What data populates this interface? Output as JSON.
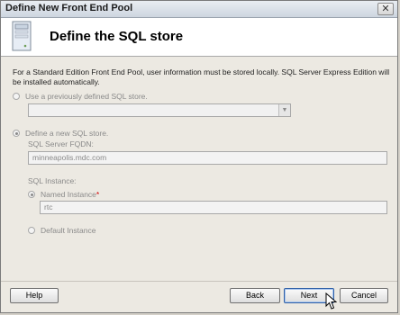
{
  "window": {
    "title": "Define New Front End Pool",
    "close_glyph": "✕"
  },
  "header": {
    "title": "Define the SQL store",
    "icon": "server-icon"
  },
  "description": "For a Standard Edition Front End Pool, user information must be stored locally.  SQL Server Express Edition will be installed automatically.",
  "options": {
    "use_existing": {
      "label": "Use a previously defined SQL store.",
      "selected": false,
      "combo_value": ""
    },
    "define_new": {
      "label": "Define a new SQL store.",
      "selected": true,
      "fqdn_label": "SQL Server FQDN:",
      "fqdn_value": "minneapolis.mdc.com",
      "instance_label": "SQL Instance:",
      "named_instance_label": "Named Instance",
      "required_marker": "*",
      "named_instance_selected": true,
      "named_instance_value": "rtc",
      "default_instance_label": "Default Instance",
      "default_instance_selected": false
    }
  },
  "buttons": {
    "help": "Help",
    "back": "Back",
    "next": "Next",
    "cancel": "Cancel"
  },
  "colors": {
    "disabled_text": "#8a8a8a",
    "required": "#d00000",
    "default_button_border": "#2f5fa6"
  }
}
